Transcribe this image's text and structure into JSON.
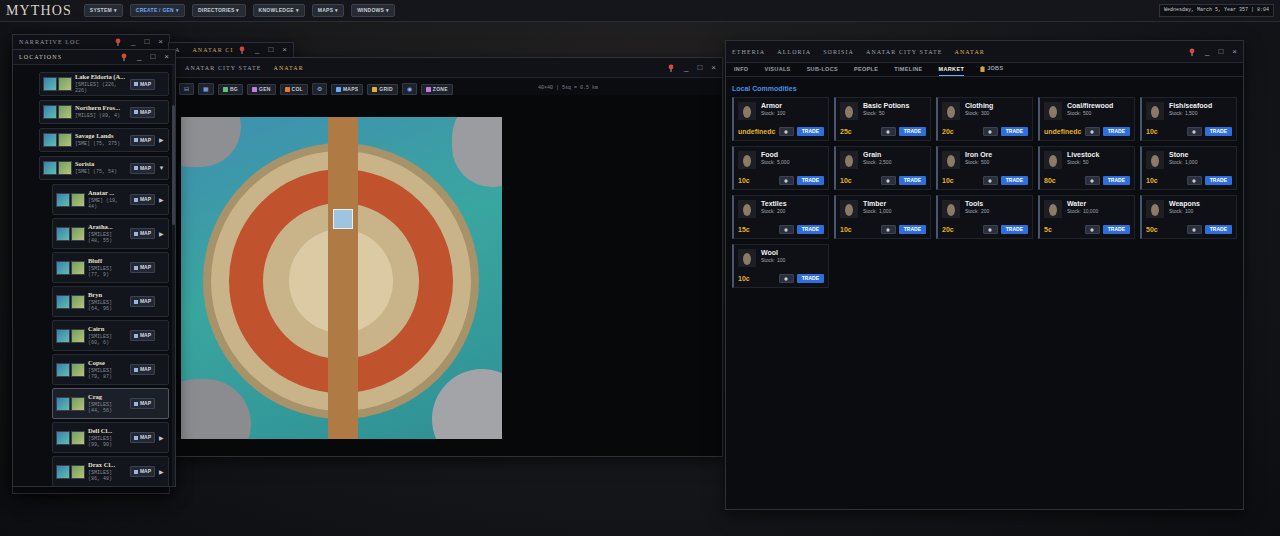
{
  "topbar": {
    "logo": "MYTHOS",
    "menus": [
      {
        "label": "SYSTEM ▾",
        "selected": false
      },
      {
        "label": "CREATE / GEN ▾",
        "selected": true
      },
      {
        "label": "DIRECTORIES ▾",
        "selected": false
      },
      {
        "label": "KNOWLEDGE ▾",
        "selected": false
      },
      {
        "label": "MAPS ▾",
        "selected": false
      },
      {
        "label": "WINDOWS ▾",
        "selected": false
      }
    ],
    "clock": "Wednesday, March 5, Year 357 | 8:04"
  },
  "narrative_window": {
    "title": "NARRATIVE LOC",
    "controls": [
      "_",
      "□",
      "×"
    ]
  },
  "locations_window": {
    "title": "LOCATIONS",
    "controls": [
      "_",
      "□",
      "×"
    ],
    "items": [
      {
        "name": "Lake Eldoria (A...",
        "coords": "[SMILES] (226, 226)",
        "map": "MAP",
        "selected": false
      },
      {
        "name": "Northern Fros...",
        "coords": "[MILES] (89, 4)",
        "map": "MAP",
        "selected": false
      },
      {
        "name": "Savage Lands",
        "coords": "[SME] (75, 375)",
        "map": "MAP",
        "toggle": "▶",
        "expanded": false,
        "selected": false
      },
      {
        "name": "Sorisia",
        "coords": "[SME] (75, 54)",
        "map": "MAP",
        "toggle": "▼",
        "expanded": true,
        "selected": false,
        "children": [
          {
            "name": "Anatar ...",
            "coords": "[SME] (19, 44)",
            "map": "MAP",
            "toggle": "▶",
            "expanded": false,
            "selected": false
          },
          {
            "name": "Aratha...",
            "coords": "[SMILES] (48, 55)",
            "map": "MAP",
            "toggle": "▶",
            "expanded": false,
            "selected": false
          },
          {
            "name": "Bluff",
            "coords": "[SMILES] (77, 9)",
            "map": "MAP",
            "selected": false
          },
          {
            "name": "Bryn",
            "coords": "[SMILES] (64, 96)",
            "map": "MAP",
            "selected": false
          },
          {
            "name": "Cairn",
            "coords": "[SMILES] (60, 6)",
            "map": "MAP",
            "selected": false
          },
          {
            "name": "Copse",
            "coords": "[SMILES] (79, 87)",
            "map": "MAP",
            "selected": false
          },
          {
            "name": "Crag",
            "coords": "[SMILES] (44, 56)",
            "map": "MAP",
            "selected": true
          },
          {
            "name": "Dell Cl...",
            "coords": "[SMILES] (99, 90)",
            "map": "MAP",
            "toggle": "▶",
            "expanded": false,
            "selected": false
          },
          {
            "name": "Drax Cl...",
            "coords": "[SMILES] (86, 48)",
            "map": "MAP",
            "toggle": "▶",
            "expanded": false,
            "selected": false
          }
        ]
      }
    ]
  },
  "back_window": {
    "breadcrumb": [
      "A",
      "ANATAR CI"
    ],
    "controls": [
      "_",
      "□",
      "×"
    ]
  },
  "map_window": {
    "breadcrumb": [
      "ANATAR CITY STATE",
      "ANATAR"
    ],
    "controls": [
      "_",
      "□",
      "×"
    ],
    "toolbar": [
      {
        "label": "⊟",
        "kind": "icon"
      },
      {
        "label": "▦",
        "kind": "icon"
      },
      {
        "label": "BG",
        "kind": "text"
      },
      {
        "label": "GEN",
        "kind": "text"
      },
      {
        "label": "COL",
        "kind": "text"
      },
      {
        "label": "⚙",
        "kind": "icon"
      },
      {
        "label": "MAPS",
        "kind": "text"
      },
      {
        "label": "GRID",
        "kind": "text"
      },
      {
        "label": "◉",
        "kind": "icon"
      },
      {
        "label": "ZONE",
        "kind": "text"
      }
    ],
    "scale": "40×40 | 5sq = 0.5 km"
  },
  "location_window": {
    "breadcrumb": [
      "ETHERIA",
      "ALLORIA",
      "SORISIA",
      "ANATAR CITY STATE",
      "ANATAR"
    ],
    "controls": [
      "_",
      "□",
      "×"
    ],
    "tabs": [
      {
        "label": "INFO",
        "selected": false,
        "kind": "plain"
      },
      {
        "label": "VISUALS",
        "selected": false,
        "kind": "plain"
      },
      {
        "label": "SUB-LOCS",
        "selected": false,
        "kind": "plain"
      },
      {
        "label": "PEOPLE",
        "selected": false,
        "kind": "plain"
      },
      {
        "label": "TIMELINE",
        "selected": false,
        "kind": "plain"
      },
      {
        "label": "MARKET",
        "selected": true,
        "kind": "plain"
      },
      {
        "label": "JOBS",
        "selected": false,
        "kind": "icon"
      }
    ],
    "market": {
      "heading": "Local Commodities",
      "stock_label": "Stock:",
      "trade": "TRADE",
      "items": [
        {
          "name": "Armor",
          "stock": "100",
          "price": "undefinedc"
        },
        {
          "name": "Basic Potions",
          "stock": "50",
          "price": "25c"
        },
        {
          "name": "Clothing",
          "stock": "300",
          "price": "20c"
        },
        {
          "name": "Coal/firewood",
          "stock": "500",
          "price": "undefinedc"
        },
        {
          "name": "Fish/seafood",
          "stock": "1,500",
          "price": "10c"
        },
        {
          "name": "Food",
          "stock": "5,000",
          "price": "10c"
        },
        {
          "name": "Grain",
          "stock": "2,500",
          "price": "10c"
        },
        {
          "name": "Iron Ore",
          "stock": "500",
          "price": "10c"
        },
        {
          "name": "Livestock",
          "stock": "50",
          "price": "80c"
        },
        {
          "name": "Stone",
          "stock": "1,000",
          "price": "10c"
        },
        {
          "name": "Textiles",
          "stock": "200",
          "price": "15c"
        },
        {
          "name": "Timber",
          "stock": "1,000",
          "price": "10c"
        },
        {
          "name": "Tools",
          "stock": "200",
          "price": "20c"
        },
        {
          "name": "Water",
          "stock": "10,000",
          "price": "5c"
        },
        {
          "name": "Weapons",
          "stock": "100",
          "price": "50c"
        },
        {
          "name": "Wool",
          "stock": "100",
          "price": "10c"
        }
      ]
    }
  }
}
